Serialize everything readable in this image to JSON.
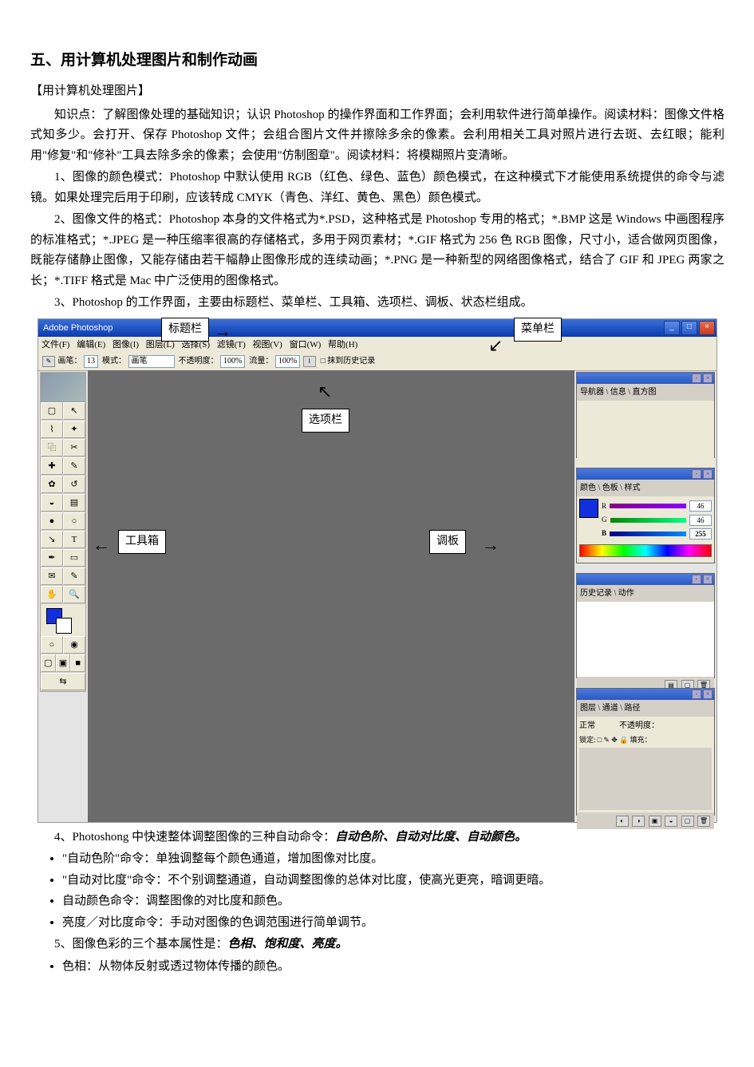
{
  "doc": {
    "title": "五、用计算机处理图片和制作动画",
    "section_bracket": "【用计算机处理图片】",
    "para_intro": "知识点：了解图像处理的基础知识；认识 Photoshop 的操作界面和工作界面；会利用软件进行简单操作。阅读材料：图像文件格式知多少。会打开、保存 Photoshop 文件；会组合图片文件并擦除多余的像素。会利用相关工具对照片进行去斑、去红眼；能利用\"修复\"和\"修补\"工具去除多余的像素；会使用\"仿制图章\"。阅读材料：将模糊照片变清晰。",
    "para1": "1、图像的颜色模式：Photoshop 中默认使用 RGB（红色、绿色、蓝色）颜色模式，在这种模式下才能使用系统提供的命令与滤镜。如果处理完后用于印刷，应该转成 CMYK（青色、洋红、黄色、黑色）颜色模式。",
    "para2": "2、图像文件的格式：Photoshop 本身的文件格式为*.PSD，这种格式是 Photoshop 专用的格式；*.BMP 这是 Windows 中画图程序的标准格式；*.JPEG 是一种压缩率很高的存储格式，多用于网页素材；*.GIF 格式为 256 色 RGB 图像，尺寸小，适合做网页图像，既能存储静止图像，又能存储由若干幅静止图像形成的连续动画；*.PNG 是一种新型的网络图像格式，结合了 GIF 和 JPEG 两家之长；*.TIFF 格式是 Mac 中广泛使用的图像格式。",
    "para3": "3、Photoshop 的工作界面，主要由标题栏、菜单栏、工具箱、选项栏、调板、状态栏组成。",
    "para4_lead": "4、Photoshong 中快速整体调整图像的三种自动命令：",
    "para4_bold": "自动色阶、自动对比度、自动颜色。",
    "bullets4": [
      "\"自动色阶\"命令：单独调整每个颜色通道，增加图像对比度。",
      "\"自动对比度\"命令：不个别调整通道，自动调整图像的总体对比度，使高光更亮，暗调更暗。",
      "自动颜色命令：调整图像的对比度和颜色。",
      "亮度／对比度命令：手动对图像的色调范围进行简单调节。"
    ],
    "para5_lead": "5、图像色彩的三个基本属性是：",
    "para5_bold": "色相、饱和度、亮度。",
    "bullets5": [
      "色相：从物体反射或透过物体传播的颜色。"
    ]
  },
  "ps": {
    "app_title": "Adobe Photoshop",
    "menus": [
      "文件(F)",
      "编辑(E)",
      "图像(I)",
      "图层(L)",
      "选择(S)",
      "滤镜(T)",
      "视图(V)",
      "窗口(W)",
      "帮助(H)"
    ],
    "options": {
      "brush_label": "画笔：",
      "brush_size": "13",
      "mode_label": "模式：",
      "mode_value": "画笔",
      "opacity_label": "不透明度：",
      "opacity_value": "100%",
      "flow_label": "流量：",
      "flow_value": "100%",
      "history_checkbox": "抹到历史记录"
    },
    "labels": {
      "title_bar": "标题栏",
      "menu_bar": "菜单栏",
      "options_bar": "选项栏",
      "toolbox": "工具箱",
      "palette": "调板"
    },
    "panels": {
      "nav_tabs": "导航器 \\ 信息 \\ 直方图",
      "color_tabs": "颜色 \\ 色板 \\ 样式",
      "r_label": "R",
      "r_val": "46",
      "g_label": "G",
      "g_val": "46",
      "b_label": "B",
      "b_val": "255",
      "history_tabs": "历史记录 \\ 动作",
      "layers_tabs": "图层 \\ 通道 \\ 路径",
      "layers_mode": "正常",
      "layers_op_label": "不透明度：",
      "layers_lock": "锁定: □ ✎ ✥ 🔒   填充："
    },
    "swatch_fg": "#1030e0",
    "swatch_bg": "#ffffff"
  }
}
